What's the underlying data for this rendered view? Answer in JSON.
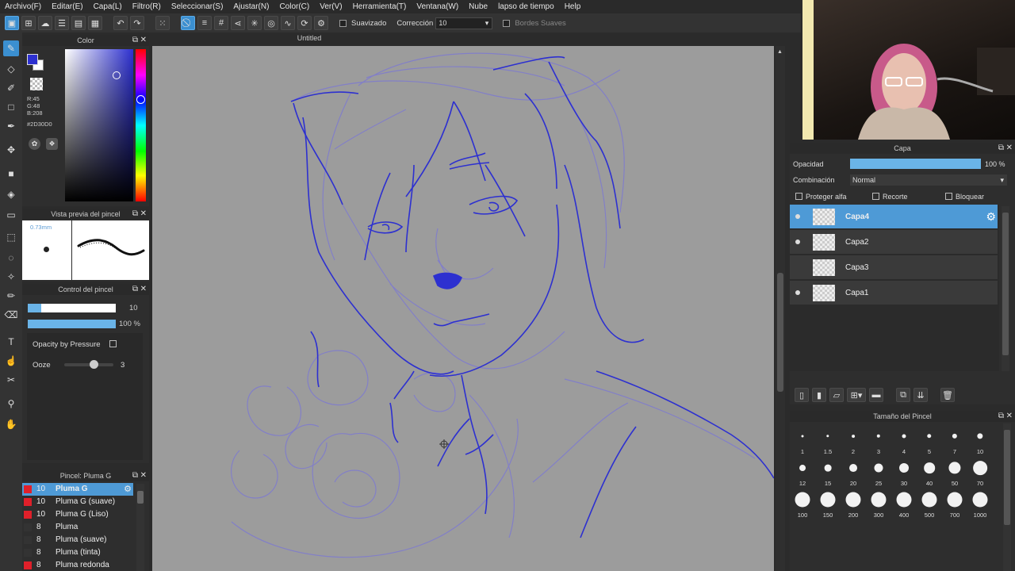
{
  "menu": [
    "Archivo(F)",
    "Editar(E)",
    "Capa(L)",
    "Filtro(R)",
    "Seleccionar(S)",
    "Ajustar(N)",
    "Color(C)",
    "Ver(V)",
    "Herramienta(T)",
    "Ventana(W)",
    "Nube",
    "lapso de tiempo",
    "Help"
  ],
  "toolbar": {
    "smoothing_label": "Suavizado",
    "correction_label": "Corrección",
    "correction_value": "10",
    "soft_edges_label": "Bordes Suaves"
  },
  "color_panel": {
    "title": "Color",
    "r": "R:45",
    "g": "G:48",
    "b": "B:208",
    "hex": "#2D30D0",
    "primary_color": "#2D30D0"
  },
  "brush_preview": {
    "title": "Vista previa del pincel",
    "size": "0.73mm"
  },
  "brush_control": {
    "title": "Control del pincel",
    "size_value": "10",
    "size_fraction": 0.15,
    "opacity_value": "100 %",
    "opacity_fraction": 1.0,
    "opacity_pressure_label": "Opacity by Pressure",
    "ooze_label": "Ooze",
    "ooze_value": "3"
  },
  "brush_list": {
    "title": "Pincel: Pluma G",
    "items": [
      {
        "size": "10",
        "name": "Pluma G",
        "color": "#e0202a"
      },
      {
        "size": "10",
        "name": "Pluma G (suave)",
        "color": "#e0202a"
      },
      {
        "size": "10",
        "name": "Pluma G (Liso)",
        "color": "#e0202a"
      },
      {
        "size": "8",
        "name": "Pluma",
        "color": "#333333"
      },
      {
        "size": "8",
        "name": "Pluma (suave)",
        "color": "#333333"
      },
      {
        "size": "8",
        "name": "Pluma (tinta)",
        "color": "#333333"
      },
      {
        "size": "8",
        "name": "Pluma redonda",
        "color": "#e0202a"
      }
    ]
  },
  "canvas": {
    "title": "Untitled"
  },
  "layer_panel": {
    "title": "Capa",
    "opacity_label": "Opacidad",
    "opacity_value": "100 %",
    "blend_label": "Combinación",
    "blend_value": "Normal",
    "protect_alpha": "Proteger alfa",
    "clipping": "Recorte",
    "lock": "Bloquear",
    "layers": [
      "Capa4",
      "Capa2",
      "Capa3",
      "Capa1"
    ]
  },
  "brush_size_panel": {
    "title": "Tamaño del Pincel",
    "sizes": [
      "1",
      "1.5",
      "2",
      "3",
      "4",
      "5",
      "7",
      "10",
      "12",
      "15",
      "20",
      "25",
      "30",
      "40",
      "50",
      "70",
      "100",
      "150",
      "200",
      "300",
      "400",
      "500",
      "700",
      "1000"
    ]
  }
}
